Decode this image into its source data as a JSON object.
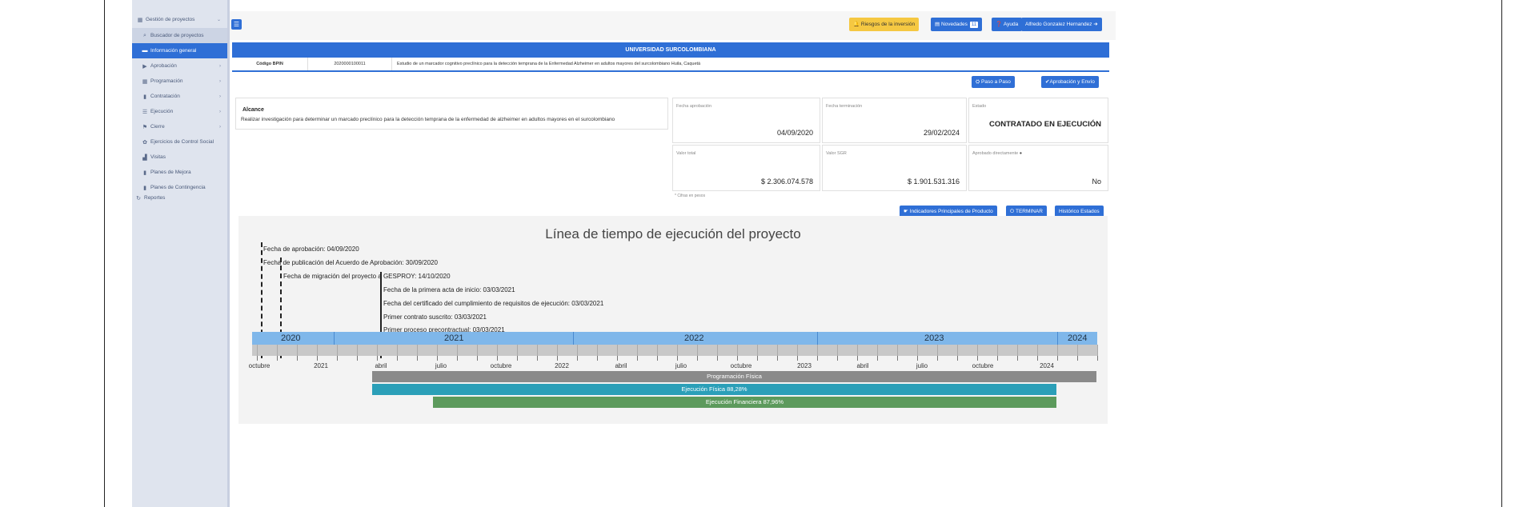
{
  "sidebar": {
    "items": [
      {
        "icon": "chart-icon",
        "label": "Gestión de proyectos",
        "arrow": "⌄"
      },
      {
        "icon": "search-icon",
        "label": "Buscador de proyectos",
        "arrow": ""
      },
      {
        "icon": "info-icon",
        "label": "Información general",
        "arrow": ""
      },
      {
        "icon": "arrow-right-icon",
        "label": "Aprobación",
        "arrow": "›"
      },
      {
        "icon": "calendar-icon",
        "label": "Programación",
        "arrow": "›"
      },
      {
        "icon": "file-icon",
        "label": "Contratación",
        "arrow": "›"
      },
      {
        "icon": "list-icon",
        "label": "Ejecución",
        "arrow": "›"
      },
      {
        "icon": "flag-icon",
        "label": "Cierre",
        "arrow": "›"
      },
      {
        "icon": "users-icon",
        "label": "Ejercicios de Control Social",
        "arrow": ""
      },
      {
        "icon": "bar-chart-icon",
        "label": "Visitas",
        "arrow": ""
      },
      {
        "icon": "document-icon",
        "label": "Planes de Mejora",
        "arrow": ""
      },
      {
        "icon": "document-icon",
        "label": "Planes de Contingencia",
        "arrow": ""
      },
      {
        "icon": "refresh-icon",
        "label": "Reportes",
        "arrow": ""
      }
    ]
  },
  "topbar": {
    "riesgos": "Riesgos de la inversión",
    "novedades": "Novedades",
    "novedades_count": "11",
    "ayuda": "Ayuda",
    "user": "Alfredo Gonzalez Hernandez"
  },
  "header": {
    "entity": "UNIVERSIDAD SURCOLOMBIANA",
    "bpin_label": "Código BPIN",
    "bpin_value": "2020000100011",
    "project_name": "Estudio de un marcador cognitivo preclínico para la detección temprana de la Enfermedad Alzheimer en adultos mayores del surcolombiano Huila, Caquetá"
  },
  "actions": {
    "paso_a_paso": "Paso a Paso",
    "aprobacion_envio": "Aprobación y Envío",
    "indicadores": "Indicadores Principales de Producto",
    "terminar": "TERMINAR",
    "historico": "Histórico Estados"
  },
  "alcance": {
    "title": "Alcance",
    "text": "Realizar investigación para determinar un marcado preclínico para la detección temprana de la enfermedad de alzheimer en adultos mayores en el surcolombiano"
  },
  "cards": {
    "fecha_aprobacion": {
      "label": "Fecha aprobación",
      "value": "04/09/2020"
    },
    "fecha_terminacion": {
      "label": "Fecha terminación",
      "value": "29/02/2024"
    },
    "estado": {
      "label": "Estado",
      "value": "CONTRATADO EN EJECUCIÓN"
    },
    "valor_total": {
      "label": "Valor total",
      "value": "$ 2.306.074.578"
    },
    "valor_sgr": {
      "label": "Valor SGR",
      "value": "$ 1.901.531.316"
    },
    "aprobado": {
      "label": "Aprobado directamente",
      "value": "No"
    },
    "note": "* Cifras en pesos"
  },
  "timeline": {
    "title": "Línea de tiempo de ejecución del proyecto",
    "events": [
      "Fecha de aprobación: 04/09/2020",
      "Fecha de publicación del Acuerdo de Aprobación: 30/09/2020",
      "Fecha de migración del proyecto a GESPROY: 14/10/2020",
      "Fecha de la primera acta de inicio: 03/03/2021",
      "Fecha del certificado del cumplimiento de requisitos de ejecución: 03/03/2021",
      "Primer contrato suscrito: 03/03/2021",
      "Primer proceso precontractual: 03/03/2021"
    ],
    "years": [
      "2020",
      "2021",
      "2022",
      "2023",
      "2024"
    ],
    "axis_labels": [
      "octubre",
      "2021",
      "abril",
      "julio",
      "octubre",
      "2022",
      "abril",
      "julio",
      "octubre",
      "2023",
      "abril",
      "julio",
      "octubre",
      "2024"
    ],
    "bars": {
      "programacion": {
        "label": "Programación Física",
        "color": "#8a8a8a"
      },
      "ejecucion_fisica": {
        "label": "Ejecución Física 88,28%",
        "color": "#2b9fb8"
      },
      "ejecucion_financiera": {
        "label": "Ejecución Financiera 87,96%",
        "color": "#5c9a5c"
      }
    }
  }
}
